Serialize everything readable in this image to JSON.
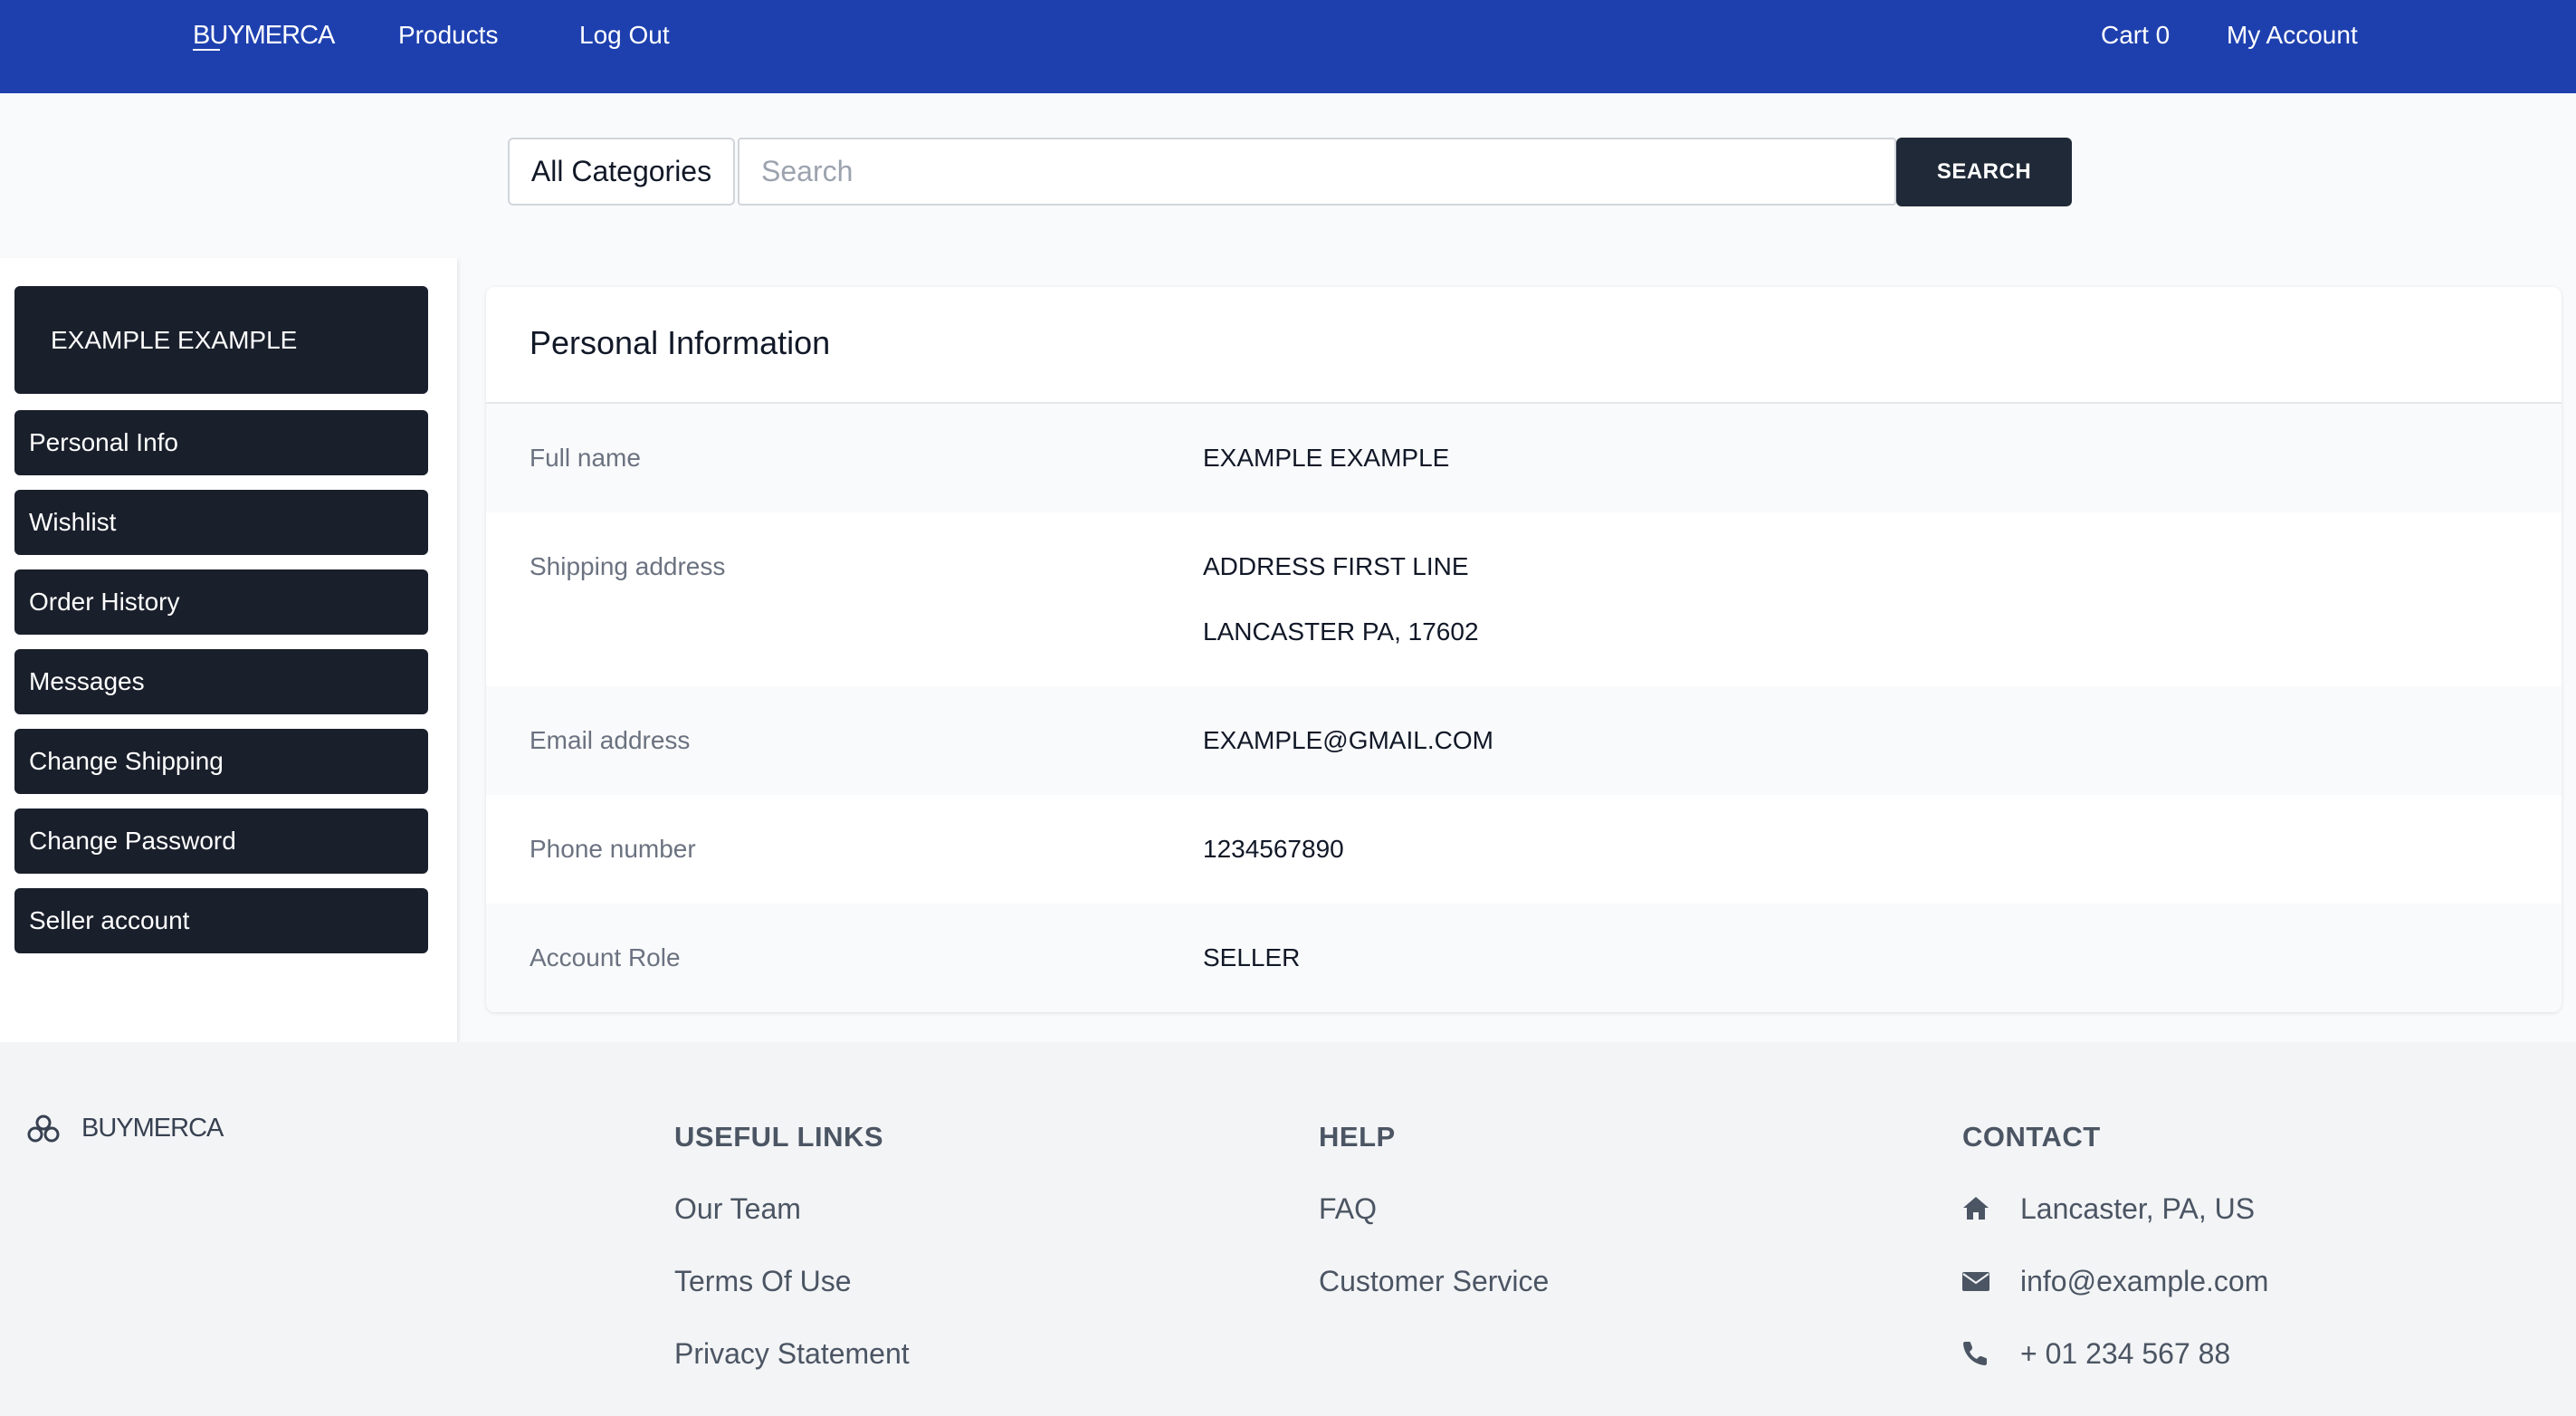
{
  "header": {
    "brand": "BUYMERCA",
    "nav": {
      "products": "Products",
      "logout": "Log Out",
      "cart": "Cart 0",
      "account": "My Account"
    }
  },
  "search": {
    "category": "All Categories",
    "placeholder": "Search",
    "button": "SEARCH"
  },
  "sidebar": {
    "user_name": "EXAMPLE EXAMPLE",
    "items": [
      {
        "label": "Personal Info"
      },
      {
        "label": "Wishlist"
      },
      {
        "label": "Order History"
      },
      {
        "label": "Messages"
      },
      {
        "label": "Change Shipping"
      },
      {
        "label": "Change Password"
      },
      {
        "label": "Seller account"
      }
    ]
  },
  "profile": {
    "title": "Personal Information",
    "full_name_label": "Full name",
    "full_name": "EXAMPLE EXAMPLE",
    "shipping_label": "Shipping address",
    "shipping_line1": "ADDRESS FIRST LINE",
    "shipping_line2": "LANCASTER PA, 17602",
    "email_label": "Email address",
    "email": "EXAMPLE@GMAIL.COM",
    "phone_label": "Phone number",
    "phone": "1234567890",
    "role_label": "Account Role",
    "role": "SELLER"
  },
  "footer": {
    "brand": "BUYMERCA",
    "useful_links": {
      "heading": "USEFUL LINKS",
      "links": [
        "Our Team",
        "Terms Of Use",
        "Privacy Statement"
      ]
    },
    "help": {
      "heading": "HELP",
      "links": [
        "FAQ",
        "Customer Service"
      ]
    },
    "contact": {
      "heading": "CONTACT",
      "address": "Lancaster, PA, US",
      "email": "info@example.com",
      "phone": "+ 01 234 567 88"
    }
  },
  "colors": {
    "header_bg": "#1e40af",
    "sidebar_button": "#191f2b",
    "search_button": "#1f2937"
  },
  "icons": [
    "logo-icon",
    "home-icon",
    "envelope-icon",
    "phone-icon"
  ]
}
